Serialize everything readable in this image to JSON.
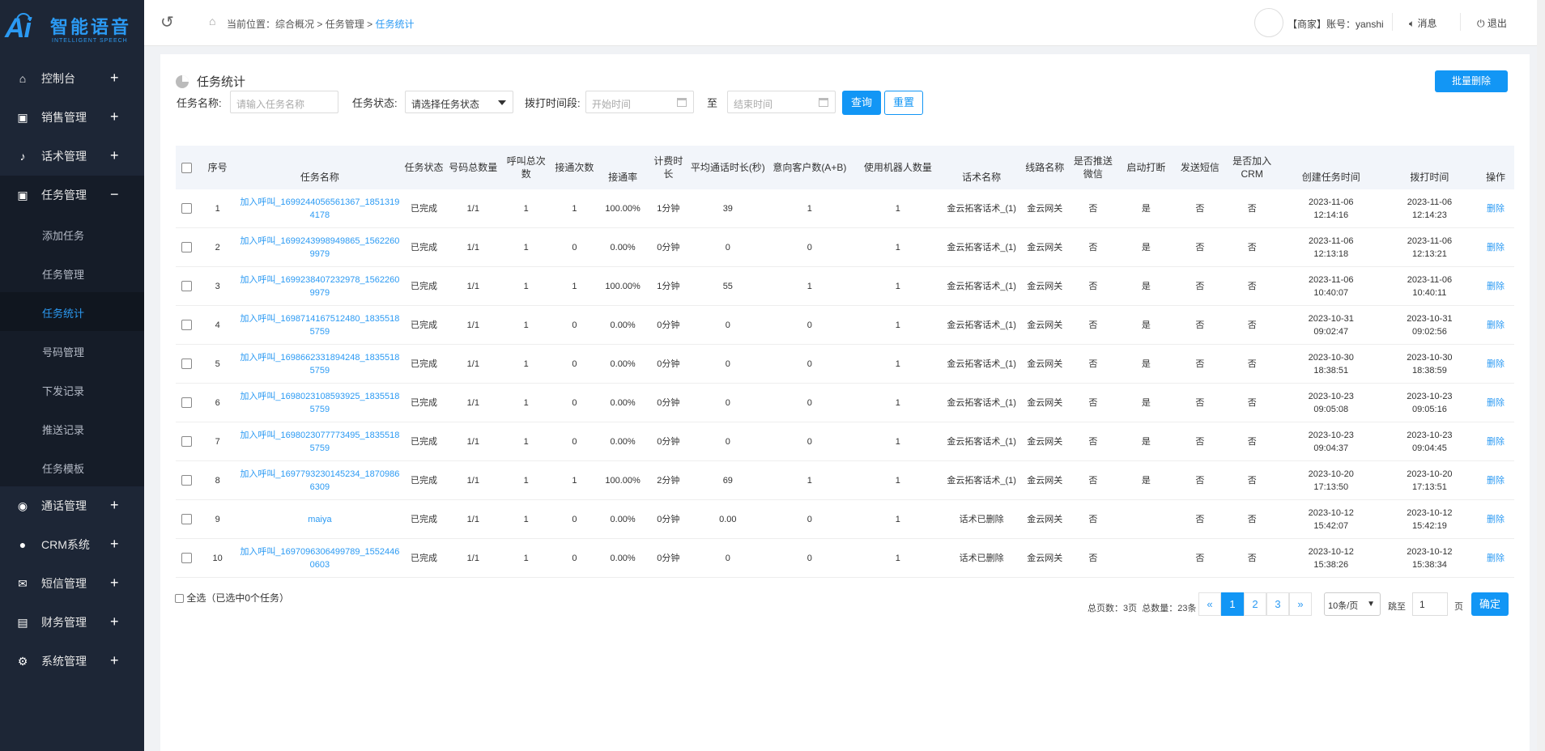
{
  "brand": {
    "logo_mark": "Ai",
    "name_cn": "智能语音",
    "name_en": "INTELLIGENT SPEECH"
  },
  "sidebar": {
    "items": [
      {
        "label": "控制台",
        "icon": "home-icon",
        "sign": "+"
      },
      {
        "label": "销售管理",
        "icon": "clipboard-icon",
        "sign": "+"
      },
      {
        "label": "话术管理",
        "icon": "microphone-icon",
        "sign": "+"
      },
      {
        "label": "任务管理",
        "icon": "task-icon",
        "sign": "−"
      },
      {
        "label": "通话管理",
        "icon": "phone-icon",
        "sign": "+"
      },
      {
        "label": "CRM系统",
        "icon": "users-icon",
        "sign": "+"
      },
      {
        "label": "短信管理",
        "icon": "mail-icon",
        "sign": "+"
      },
      {
        "label": "财务管理",
        "icon": "wallet-icon",
        "sign": "+"
      },
      {
        "label": "系统管理",
        "icon": "gear-icon",
        "sign": "+"
      }
    ],
    "submenu": [
      "添加任务",
      "任务管理",
      "任务统计",
      "号码管理",
      "下发记录",
      "推送记录",
      "任务模板"
    ]
  },
  "header": {
    "breadcrumb_prefix": "当前位置：",
    "crumb1": "综合概况",
    "sep": ">",
    "crumb2": "任务管理",
    "crumb3": "任务统计",
    "account": "【商家】账号：yanshi",
    "message": "消息",
    "logout": "退出"
  },
  "panel": {
    "title": "任务统计",
    "batch_delete": "批量删除",
    "filters": {
      "name_label": "任务名称:",
      "name_placeholder": "请输入任务名称",
      "status_label": "任务状态:",
      "status_value": "请选择任务状态",
      "period_label": "拨打时间段:",
      "start_placeholder": "开始时间",
      "to": "至",
      "end_placeholder": "结束时间",
      "query": "查询",
      "reset": "重置"
    }
  },
  "table": {
    "headers": [
      "序号",
      "任务名称",
      "任务状态",
      "号码总数量",
      "呼叫总次数",
      "接通次数",
      "接通率",
      "计费时长",
      "平均通话时长(秒)",
      "意向客户数(A+B)",
      "使用机器人数量",
      "话术名称",
      "线路名称",
      "是否推送微信",
      "启动打断",
      "发送短信",
      "是否加入CRM",
      "创建任务时间",
      "拨打时间",
      "操作"
    ],
    "rows": [
      {
        "no": "1",
        "name": "加入呼叫_1699244056561367_18513194178",
        "status": "已完成",
        "numbers": "1/1",
        "calls": "1",
        "connects": "1",
        "rate": "100.00%",
        "billing": "1分钟",
        "avg": "39",
        "intent": "1",
        "robots": "1",
        "script": "金云拓客话术_(1)",
        "line": "金云网关",
        "wechat": "否",
        "interrupt": "是",
        "sms": "否",
        "crm": "否",
        "created": "2023-11-06 12:14:16",
        "dialed": "2023-11-06 12:14:23",
        "op": "删除"
      },
      {
        "no": "2",
        "name": "加入呼叫_1699243998949865_15622609979",
        "status": "已完成",
        "numbers": "1/1",
        "calls": "1",
        "connects": "0",
        "rate": "0.00%",
        "billing": "0分钟",
        "avg": "0",
        "intent": "0",
        "robots": "1",
        "script": "金云拓客话术_(1)",
        "line": "金云网关",
        "wechat": "否",
        "interrupt": "是",
        "sms": "否",
        "crm": "否",
        "created": "2023-11-06 12:13:18",
        "dialed": "2023-11-06 12:13:21",
        "op": "删除"
      },
      {
        "no": "3",
        "name": "加入呼叫_1699238407232978_15622609979",
        "status": "已完成",
        "numbers": "1/1",
        "calls": "1",
        "connects": "1",
        "rate": "100.00%",
        "billing": "1分钟",
        "avg": "55",
        "intent": "1",
        "robots": "1",
        "script": "金云拓客话术_(1)",
        "line": "金云网关",
        "wechat": "否",
        "interrupt": "是",
        "sms": "否",
        "crm": "否",
        "created": "2023-11-06 10:40:07",
        "dialed": "2023-11-06 10:40:11",
        "op": "删除"
      },
      {
        "no": "4",
        "name": "加入呼叫_1698714167512480_18355185759",
        "status": "已完成",
        "numbers": "1/1",
        "calls": "1",
        "connects": "0",
        "rate": "0.00%",
        "billing": "0分钟",
        "avg": "0",
        "intent": "0",
        "robots": "1",
        "script": "金云拓客话术_(1)",
        "line": "金云网关",
        "wechat": "否",
        "interrupt": "是",
        "sms": "否",
        "crm": "否",
        "created": "2023-10-31 09:02:47",
        "dialed": "2023-10-31 09:02:56",
        "op": "删除"
      },
      {
        "no": "5",
        "name": "加入呼叫_1698662331894248_18355185759",
        "status": "已完成",
        "numbers": "1/1",
        "calls": "1",
        "connects": "0",
        "rate": "0.00%",
        "billing": "0分钟",
        "avg": "0",
        "intent": "0",
        "robots": "1",
        "script": "金云拓客话术_(1)",
        "line": "金云网关",
        "wechat": "否",
        "interrupt": "是",
        "sms": "否",
        "crm": "否",
        "created": "2023-10-30 18:38:51",
        "dialed": "2023-10-30 18:38:59",
        "op": "删除"
      },
      {
        "no": "6",
        "name": "加入呼叫_1698023108593925_18355185759",
        "status": "已完成",
        "numbers": "1/1",
        "calls": "1",
        "connects": "0",
        "rate": "0.00%",
        "billing": "0分钟",
        "avg": "0",
        "intent": "0",
        "robots": "1",
        "script": "金云拓客话术_(1)",
        "line": "金云网关",
        "wechat": "否",
        "interrupt": "是",
        "sms": "否",
        "crm": "否",
        "created": "2023-10-23 09:05:08",
        "dialed": "2023-10-23 09:05:16",
        "op": "删除"
      },
      {
        "no": "7",
        "name": "加入呼叫_1698023077773495_18355185759",
        "status": "已完成",
        "numbers": "1/1",
        "calls": "1",
        "connects": "0",
        "rate": "0.00%",
        "billing": "0分钟",
        "avg": "0",
        "intent": "0",
        "robots": "1",
        "script": "金云拓客话术_(1)",
        "line": "金云网关",
        "wechat": "否",
        "interrupt": "是",
        "sms": "否",
        "crm": "否",
        "created": "2023-10-23 09:04:37",
        "dialed": "2023-10-23 09:04:45",
        "op": "删除"
      },
      {
        "no": "8",
        "name": "加入呼叫_1697793230145234_18709866309",
        "status": "已完成",
        "numbers": "1/1",
        "calls": "1",
        "connects": "1",
        "rate": "100.00%",
        "billing": "2分钟",
        "avg": "69",
        "intent": "1",
        "robots": "1",
        "script": "金云拓客话术_(1)",
        "line": "金云网关",
        "wechat": "否",
        "interrupt": "是",
        "sms": "否",
        "crm": "否",
        "created": "2023-10-20 17:13:50",
        "dialed": "2023-10-20 17:13:51",
        "op": "删除"
      },
      {
        "no": "9",
        "name": "maiya",
        "status": "已完成",
        "numbers": "1/1",
        "calls": "1",
        "connects": "0",
        "rate": "0.00%",
        "billing": "0分钟",
        "avg": "0.00",
        "intent": "0",
        "robots": "1",
        "script": "话术已删除",
        "line": "金云网关",
        "wechat": "否",
        "interrupt": "",
        "sms": "否",
        "crm": "否",
        "created": "2023-10-12 15:42:07",
        "dialed": "2023-10-12 15:42:19",
        "op": "删除"
      },
      {
        "no": "10",
        "name": "加入呼叫_1697096306499789_15524460603",
        "status": "已完成",
        "numbers": "1/1",
        "calls": "1",
        "connects": "0",
        "rate": "0.00%",
        "billing": "0分钟",
        "avg": "0",
        "intent": "0",
        "robots": "1",
        "script": "话术已删除",
        "line": "金云网关",
        "wechat": "否",
        "interrupt": "",
        "sms": "否",
        "crm": "否",
        "created": "2023-10-12 15:38:26",
        "dialed": "2023-10-12 15:38:34",
        "op": "删除"
      }
    ]
  },
  "footer": {
    "select_all": "全选（已选中0个任务）",
    "total_pages": "总页数：3页",
    "total_count": "总数量：23条",
    "prev": "«",
    "pages": [
      "1",
      "2",
      "3"
    ],
    "next": "»",
    "page_size": "10条/页",
    "jump_label": "跳至",
    "jump_value": "1",
    "page_unit": "页",
    "confirm": "确定"
  },
  "colors": {
    "accent": "#1296f5",
    "sidebar": "#1d2636",
    "link": "#2b9af3"
  }
}
